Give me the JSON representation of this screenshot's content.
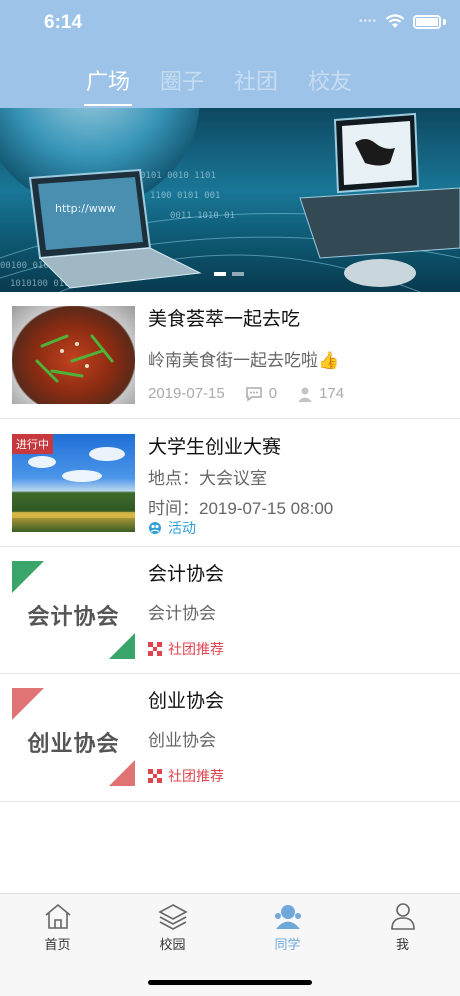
{
  "status_bar": {
    "time": "6:14"
  },
  "top_tabs": [
    {
      "label": "广场",
      "active": true
    },
    {
      "label": "圈子",
      "active": false
    },
    {
      "label": "社团",
      "active": false
    },
    {
      "label": "校友",
      "active": false
    }
  ],
  "banner": {
    "image": "computer-network-banner",
    "slide_count": 2,
    "current_slide": 1
  },
  "feed": {
    "post": {
      "title": "美食荟萃一起去吃",
      "subtitle": "岭南美食街一起去吃啦",
      "emoji": "👍",
      "date": "2019-07-15",
      "comments": "0",
      "views": "174"
    },
    "activity": {
      "status": "进行中",
      "title": "大学生创业大赛",
      "location": "地点：大会议室",
      "time": "时间：2019-07-15 08:00",
      "tag": "活动"
    },
    "clubs": [
      {
        "thumb_text": "会计协会",
        "name": "会计协会",
        "desc": "会计协会",
        "tag": "社团推荐",
        "accent": "#3aa56b"
      },
      {
        "thumb_text": "创业协会",
        "name": "创业协会",
        "desc": "创业协会",
        "tag": "社团推荐",
        "accent": "#e07474"
      }
    ]
  },
  "bottom_tabs": [
    {
      "label": "首页",
      "icon": "home-icon",
      "active": false
    },
    {
      "label": "校园",
      "icon": "layers-icon",
      "active": false
    },
    {
      "label": "同学",
      "icon": "classmates-icon",
      "active": true
    },
    {
      "label": "我",
      "icon": "person-icon",
      "active": false
    }
  ],
  "colors": {
    "header": "#9ec3e8",
    "active_tab": "#6fa9dc",
    "tag_red": "#e0454f",
    "tag_blue": "#2f9fd8"
  }
}
